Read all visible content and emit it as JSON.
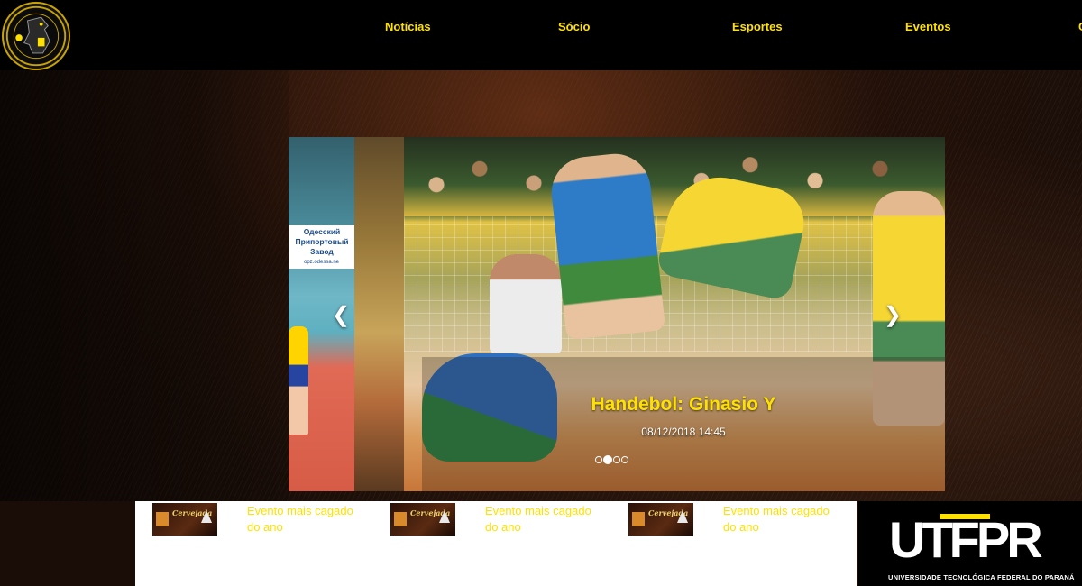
{
  "nav": {
    "items": [
      {
        "label": "Notícias"
      },
      {
        "label": "Sócio"
      },
      {
        "label": "Esportes"
      },
      {
        "label": "Eventos"
      },
      {
        "label": "C"
      }
    ]
  },
  "carousel": {
    "title": "Handebol: Ginasio Y",
    "date": "08/12/2018 14:45",
    "side_slide_board": "Одесский Припортовый Завод",
    "side_slide_url": "opz.odessa.ne",
    "active_index": 1,
    "slide_count": 4
  },
  "events": [
    {
      "title": "Evento mais cagado do ano",
      "thumb_text": "Cervejada"
    },
    {
      "title": "Evento mais cagado do ano",
      "thumb_text": "Cervejada"
    },
    {
      "title": "Evento mais cagado do ano",
      "thumb_text": "Cervejada"
    }
  ],
  "partner": {
    "logo_text": "UTFPR",
    "subtitle": "UNIVERSIDADE TECNOLÓGICA FEDERAL DO PARANÁ"
  },
  "colors": {
    "accent": "#ffe100",
    "nav_bg": "#000000"
  }
}
